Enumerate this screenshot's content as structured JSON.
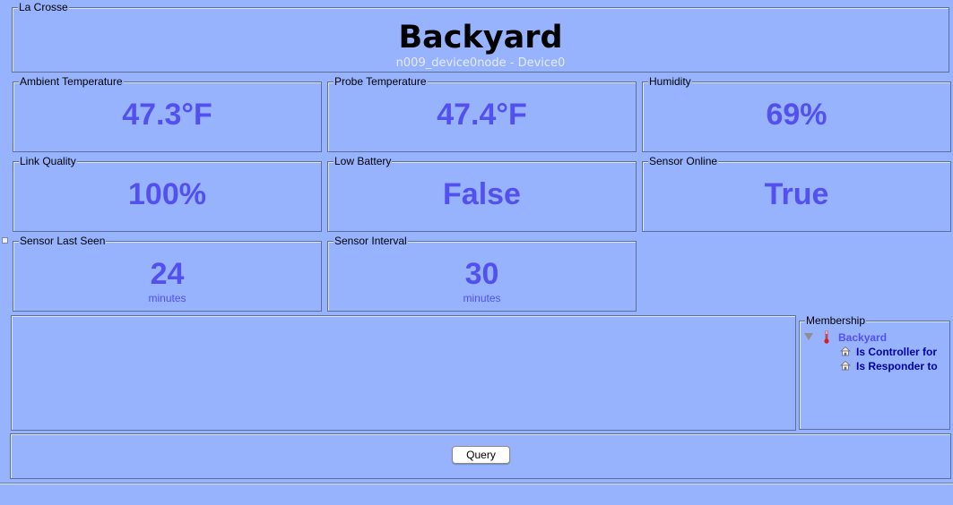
{
  "header": {
    "group_title": "La Crosse",
    "title": "Backyard",
    "subtitle": "n009_device0node - Device0"
  },
  "tiles": [
    {
      "label": "Ambient Temperature",
      "value": "47.3°F"
    },
    {
      "label": "Probe Temperature",
      "value": "47.4°F"
    },
    {
      "label": "Humidity",
      "value": "69%"
    },
    {
      "label": "Link Quality",
      "value": "100%"
    },
    {
      "label": "Low Battery",
      "value": "False"
    },
    {
      "label": "Sensor Online",
      "value": "True"
    },
    {
      "label": "Sensor Last Seen",
      "value": "24",
      "unit": "minutes"
    },
    {
      "label": "Sensor Interval",
      "value": "30",
      "unit": "minutes"
    }
  ],
  "membership": {
    "title": "Membership",
    "node": "Backyard",
    "children": [
      "Is Controller for",
      "Is Responder to"
    ]
  },
  "actions": {
    "query_label": "Query"
  },
  "colors": {
    "background": "#98b3fd",
    "value_text": "#5350f0",
    "tree_node": "#5350f0",
    "tree_child": "#0000a8"
  }
}
